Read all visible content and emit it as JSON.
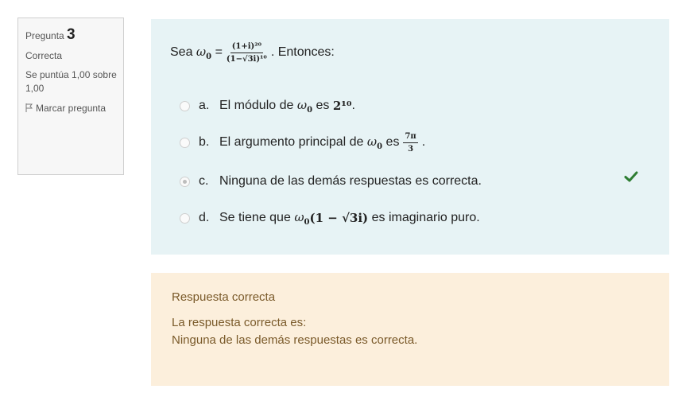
{
  "info": {
    "question_label": "Pregunta",
    "question_number": "3",
    "status": "Correcta",
    "score_text": "Se puntúa 1,00 sobre 1,00",
    "flag_label": "Marcar pregunta"
  },
  "question": {
    "prefix": "Sea",
    "fraction_numerator": "(1+i)²⁰",
    "fraction_denominator": "(1−√3i)¹⁰",
    "suffix": ". Entonces:",
    "options": [
      {
        "letter": "a.",
        "text_before": "El módulo de",
        "text_after": "es",
        "math_tail": "2¹⁰",
        "end": ".",
        "selected": false
      },
      {
        "letter": "b.",
        "text_before": "El argumento principal de",
        "text_after": "es",
        "frac_num": "7π",
        "frac_den": "3",
        "end": ".",
        "selected": false
      },
      {
        "letter": "c.",
        "text": "Ninguna de las demás respuestas es correcta.",
        "selected": true
      },
      {
        "letter": "d.",
        "text_before": "Se tiene que",
        "math_tail": "(1 − √3i)",
        "text_after": "es imaginario puro.",
        "selected": false
      }
    ],
    "correct_marker": "check-icon"
  },
  "feedback": {
    "title": "Respuesta correcta",
    "intro": "La respuesta correcta es:",
    "answer": "Ninguna de las demás respuestas es correcta."
  },
  "colors": {
    "question_bg": "#e7f3f5",
    "feedback_bg": "#fcefdc",
    "check": "#2e7d32"
  }
}
